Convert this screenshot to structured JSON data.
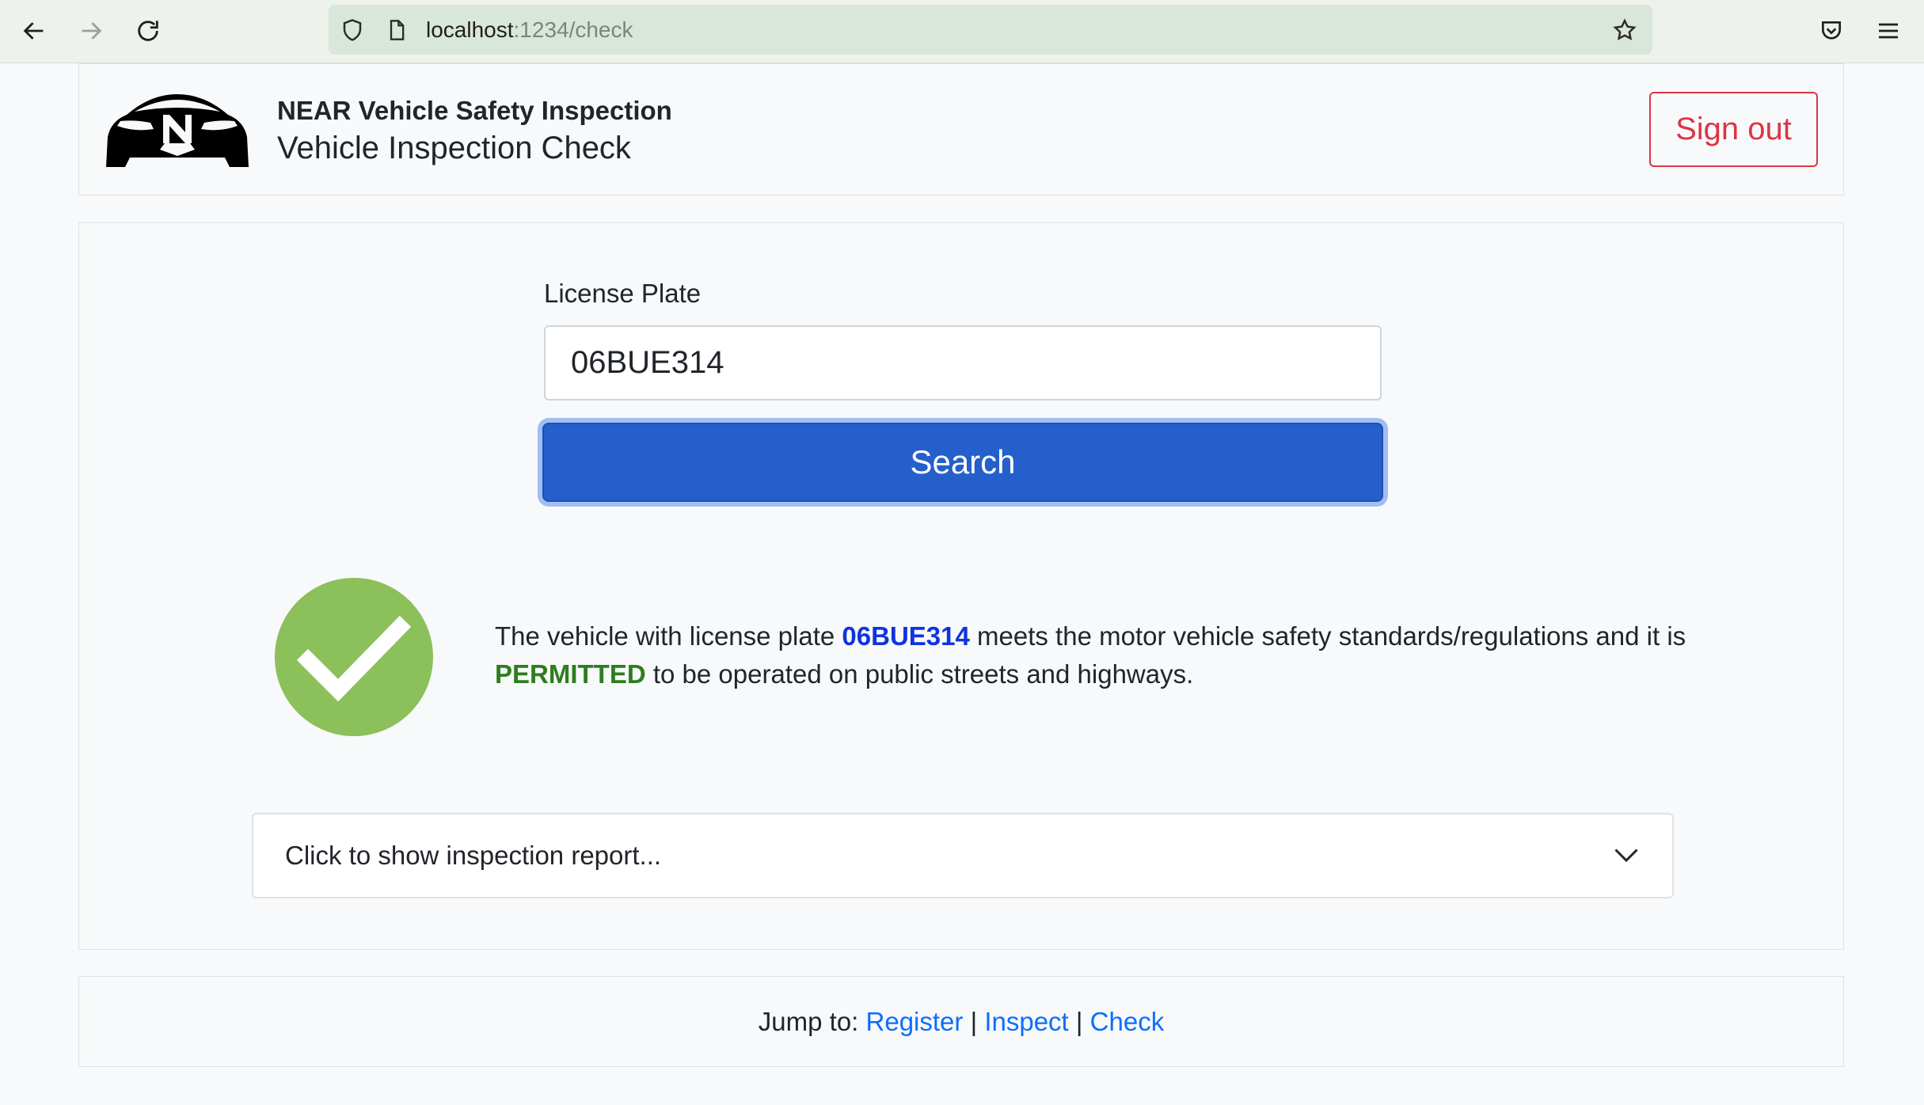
{
  "browser": {
    "url_host": "localhost",
    "url_path": ":1234/check",
    "icons": [
      "back-arrow-icon",
      "forward-arrow-icon",
      "reload-icon",
      "shield-icon",
      "page-icon",
      "bookmark-star-icon",
      "pocket-icon",
      "menu-icon"
    ]
  },
  "header": {
    "brand": "NEAR Vehicle Safety Inspection",
    "title": "Vehicle Inspection Check",
    "signout_label": "Sign out",
    "logo_icon": "car-logo-icon"
  },
  "search": {
    "label": "License Plate",
    "value": "06BUE314",
    "button_label": "Search"
  },
  "result": {
    "status_icon": "checkmark-circle-icon",
    "status_color": "#8bc05a",
    "text_before_plate": "The vehicle with license plate ",
    "plate": "06BUE314",
    "text_after_plate": " meets the motor vehicle safety standards/regulations and it is ",
    "status_word": "PERMITTED",
    "text_end": " to be operated on public streets and highways."
  },
  "report": {
    "toggle_label": "Click to show inspection report..."
  },
  "footer": {
    "prefix": "Jump to: ",
    "links": [
      "Register",
      "Inspect",
      "Check"
    ],
    "separator": "|"
  }
}
